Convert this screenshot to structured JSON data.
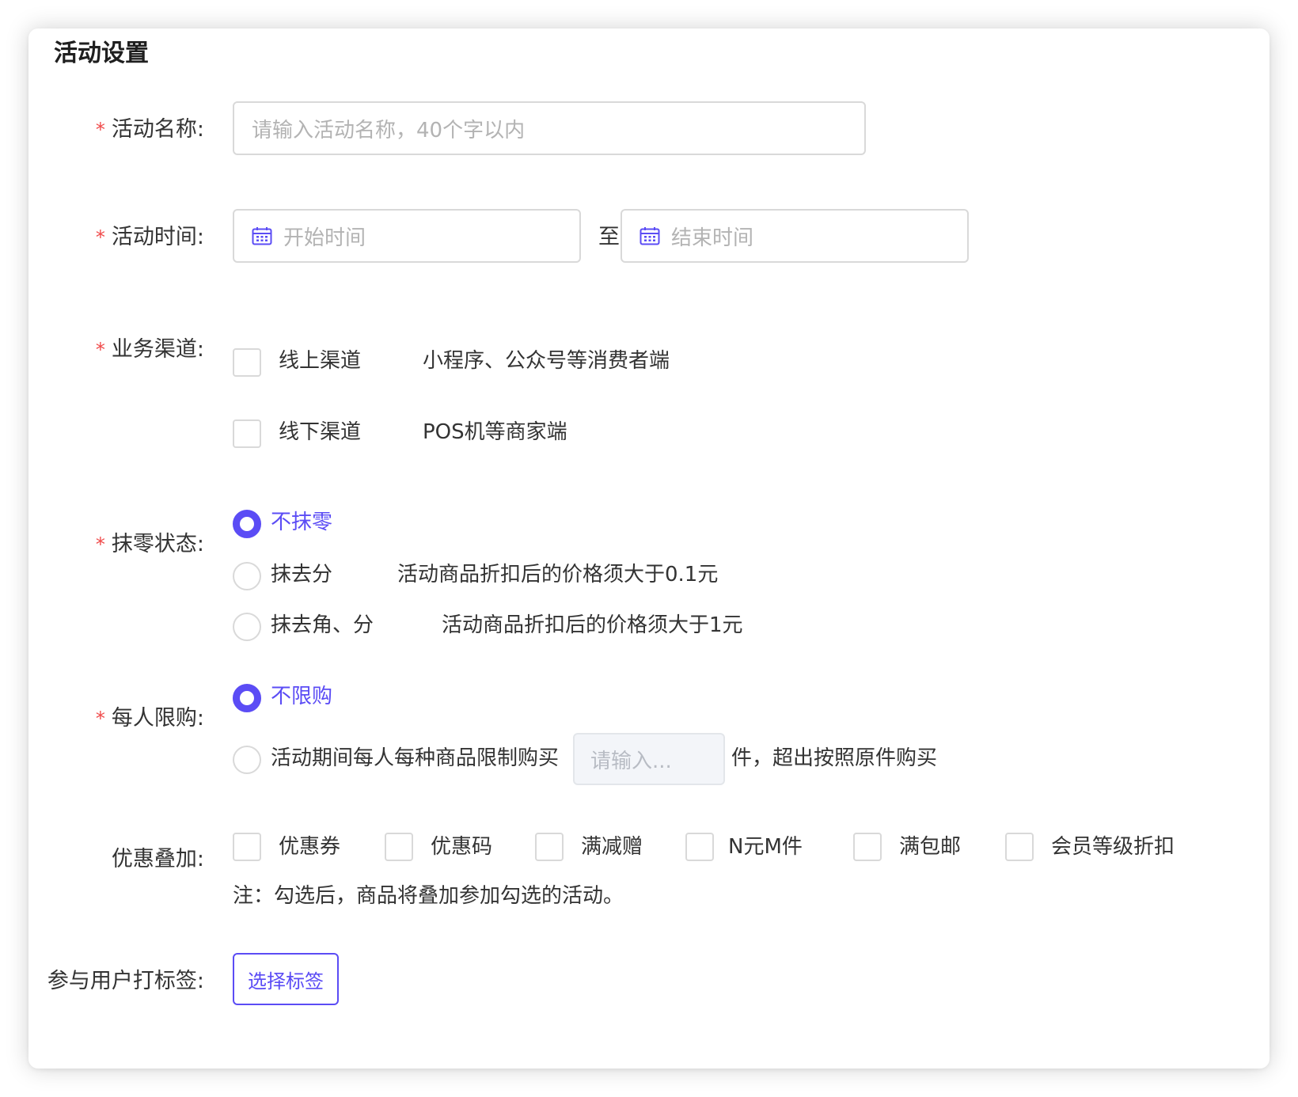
{
  "section_title": "活动设置",
  "fields": {
    "name": {
      "label": "活动名称:",
      "placeholder": "请输入活动名称，40个字以内"
    },
    "time": {
      "label": "活动时间:",
      "start_placeholder": "开始时间",
      "separator": "至",
      "end_placeholder": "结束时间"
    },
    "channel": {
      "label": "业务渠道:",
      "options": [
        {
          "label": "线上渠道",
          "desc": "小程序、公众号等消费者端"
        },
        {
          "label": "线下渠道",
          "desc": "POS机等商家端"
        }
      ]
    },
    "rounding": {
      "label": "抹零状态:",
      "options": [
        {
          "label": "不抹零",
          "desc": ""
        },
        {
          "label": "抹去分",
          "desc": "活动商品折扣后的价格须大于0.1元"
        },
        {
          "label": "抹去角、分",
          "desc": "活动商品折扣后的价格须大于1元"
        }
      ],
      "selected": "不抹零"
    },
    "limit": {
      "label": "每人限购:",
      "options": [
        {
          "label": "不限购"
        },
        {
          "label": "活动期间每人每种商品限制购买",
          "input_placeholder": "请输入...",
          "suffix": "件，超出按照原件购买"
        }
      ],
      "selected": "不限购"
    },
    "stacking": {
      "label": "优惠叠加:",
      "options": [
        "优惠券",
        "优惠码",
        "满减赠",
        "N元M件",
        "满包邮",
        "会员等级折扣"
      ],
      "note": "注：勾选后，商品将叠加参加勾选的活动。"
    },
    "user_tag": {
      "label": "参与用户打标签:",
      "button": "选择标签"
    }
  },
  "colors": {
    "accent": "#5b4cf5",
    "required": "#f04a4a",
    "border": "#d9d9d9"
  },
  "icons": {
    "date": "calendar-icon"
  }
}
